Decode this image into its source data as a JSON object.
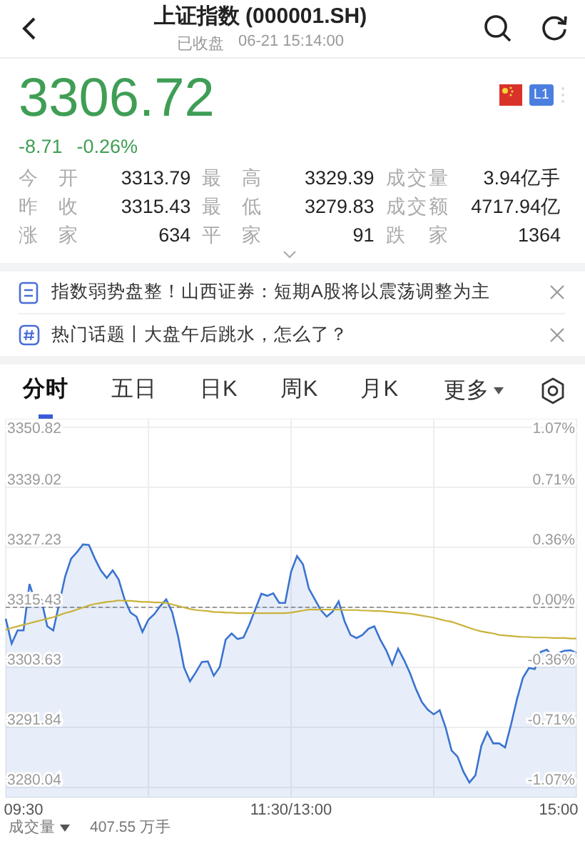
{
  "header": {
    "title": "上证指数 (000001.SH)",
    "status": "已收盘",
    "time": "06-21 15:14:00"
  },
  "quote": {
    "price": "3306.72",
    "change": "-8.71",
    "change_pct": "-0.26%",
    "level_badge": "L1"
  },
  "stats": [
    {
      "label": "今 开",
      "value": "3313.79"
    },
    {
      "label": "最 高",
      "value": "3329.39"
    },
    {
      "label": "成交量",
      "value": "3.94亿手"
    },
    {
      "label": "昨 收",
      "value": "3315.43"
    },
    {
      "label": "最 低",
      "value": "3279.83"
    },
    {
      "label": "成交额",
      "value": "4717.94亿"
    },
    {
      "label": "涨 家",
      "value": "634"
    },
    {
      "label": "平 家",
      "value": "91"
    },
    {
      "label": "跌 家",
      "value": "1364"
    }
  ],
  "news": [
    {
      "kind": "article",
      "text": "指数弱势盘整！山西证券：短期A股将以震荡调整为主"
    },
    {
      "kind": "topic",
      "text": "热门话题丨大盘午后跳水，怎么了？"
    }
  ],
  "tabs": [
    {
      "label": "分时",
      "selected": true
    },
    {
      "label": "五日",
      "selected": false
    },
    {
      "label": "日K",
      "selected": false
    },
    {
      "label": "周K",
      "selected": false
    },
    {
      "label": "月K",
      "selected": false
    }
  ],
  "more_tab": "更多",
  "chart": {
    "right_labels": [
      "1.07%",
      "0.71%",
      "0.36%",
      "0.00%",
      "-0.36%",
      "-0.71%",
      "-1.07%"
    ],
    "chart_data": {
      "type": "area",
      "grid": true,
      "categories": [
        null,
        null,
        null,
        "09:30",
        null,
        null,
        null,
        null,
        null,
        null,
        null,
        null,
        null,
        null,
        null,
        null,
        null,
        null,
        null,
        null,
        null,
        null,
        null,
        null,
        null,
        null,
        null,
        null,
        null,
        null,
        null,
        null,
        null,
        null,
        null,
        null,
        null,
        null,
        null,
        null,
        null,
        null,
        null,
        null,
        null,
        null,
        null,
        null,
        "11:30/13:00",
        null,
        null,
        null,
        null,
        null,
        null,
        null,
        null,
        null,
        null,
        null,
        null,
        null,
        null,
        null,
        null,
        null,
        null,
        null,
        null,
        null,
        null,
        null,
        null,
        null,
        null,
        null,
        null,
        null,
        null,
        null,
        null,
        null,
        null,
        null,
        null,
        null,
        null,
        null,
        null,
        null,
        null,
        null,
        null,
        "15:00",
        null,
        null,
        null
      ],
      "series": [
        {
          "color": "#3a73d0",
          "values": [
            3313.2,
            3308.3,
            3310.9,
            3310.9,
            3320.0,
            3316.4,
            3316.9,
            3311.7,
            3310.9,
            3316.2,
            3321.5,
            3325.0,
            3326.3,
            3327.8,
            3327.7,
            3325.0,
            3322.7,
            3321.2,
            3322.7,
            3320.9,
            3317.0,
            3314.4,
            3313.6,
            3310.6,
            3313.0,
            3314.1,
            3315.7,
            3317.0,
            3314.5,
            3309.7,
            3303.6,
            3300.9,
            3302.7,
            3304.7,
            3304.8,
            3302.0,
            3303.7,
            3309.1,
            3310.3,
            3309.2,
            3309.5,
            3312.1,
            3315.1,
            3318.1,
            3317.7,
            3318.2,
            3316.3,
            3316.3,
            3322.4,
            3325.5,
            3323.9,
            3319.1,
            3317.0,
            3314.9,
            3313.6,
            3314.6,
            3316.6,
            3312.7,
            3310.0,
            3309.4,
            3310.0,
            3311.2,
            3311.7,
            3309.1,
            3307.0,
            3304.2,
            3307.3,
            3305.1,
            3302.5,
            3299.4,
            3296.8,
            3295.3,
            3294.4,
            3295.2,
            3291.8,
            3287.3,
            3286.1,
            3283.1,
            3281.0,
            3282.4,
            3288.2,
            3290.9,
            3288.7,
            3288.7,
            3287.9,
            3292.4,
            3297.4,
            3301.6,
            3303.5,
            3303.3,
            3306.7,
            3307.1,
            3305.9,
            3306.5,
            3306.9,
            3307.0,
            3306.5
          ]
        },
        {
          "type": "line",
          "color": "#c9b23a",
          "values": [
            3311.0,
            3311.4,
            3311.7,
            3312.0,
            3312.3,
            3312.6,
            3312.9,
            3313.2,
            3313.5,
            3313.9,
            3314.3,
            3314.6,
            3315.0,
            3315.4,
            3315.8,
            3316.1,
            3316.3,
            3316.5,
            3316.6,
            3316.8,
            3316.7,
            3316.7,
            3316.6,
            3316.5,
            3316.5,
            3316.4,
            3316.4,
            3316.3,
            3316.0,
            3315.7,
            3315.4,
            3315.1,
            3314.9,
            3314.8,
            3314.7,
            3314.5,
            3314.5,
            3314.4,
            3314.4,
            3314.3,
            3314.3,
            3314.3,
            3314.3,
            3314.3,
            3314.3,
            3314.3,
            3314.3,
            3314.3,
            3314.4,
            3314.6,
            3314.8,
            3315.0,
            3315.0,
            3315.0,
            3315.0,
            3315.0,
            3315.0,
            3314.9,
            3314.9,
            3314.9,
            3314.8,
            3314.8,
            3314.7,
            3314.7,
            3314.6,
            3314.5,
            3314.4,
            3314.3,
            3314.2,
            3314.0,
            3313.8,
            3313.6,
            3313.4,
            3313.1,
            3312.8,
            3312.6,
            3312.2,
            3311.8,
            3311.4,
            3311.0,
            3310.7,
            3310.5,
            3310.3,
            3310.0,
            3309.9,
            3309.8,
            3309.7,
            3309.6,
            3309.6,
            3309.5,
            3309.5,
            3309.5,
            3309.4,
            3309.4,
            3309.4,
            3309.3,
            3309.3
          ]
        }
      ],
      "ref_lines": [
        {
          "axis": "y",
          "value": 3315.43
        }
      ],
      "ylim": [
        3280.04,
        3350.82
      ],
      "yticks": [
        3350.82,
        3339.02,
        3327.23,
        3315.43,
        3303.63,
        3291.84,
        3280.04
      ]
    }
  },
  "volume": {
    "label": "成交量",
    "value": "407.55 万手"
  }
}
